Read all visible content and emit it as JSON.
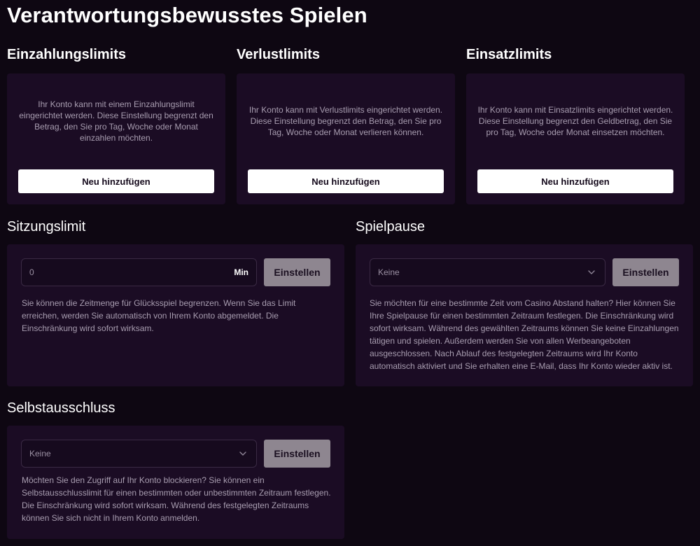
{
  "page": {
    "title": "Verantwortungsbewusstes Spielen"
  },
  "deposit_limits": {
    "title": "Einzahlungslimits",
    "text": "Ihr Konto kann mit einem Einzahlungslimit eingerichtet werden. Diese Einstellung begrenzt den Betrag, den Sie pro Tag, Woche oder Monat einzahlen möchten.",
    "button": "Neu hinzufügen"
  },
  "loss_limits": {
    "title": "Verlustlimits",
    "text": "Ihr Konto kann mit Verlustlimits eingerichtet werden. Diese Einstellung begrenzt den Betrag, den Sie pro Tag, Woche oder Monat verlieren können.",
    "button": "Neu hinzufügen"
  },
  "wager_limits": {
    "title": "Einsatzlimits",
    "text": "Ihr Konto kann mit Einsatzlimits eingerichtet werden. Diese Einstellung begrenzt den Geldbetrag, den Sie pro Tag, Woche oder Monat einsetzen möchten.",
    "button": "Neu hinzufügen"
  },
  "session_limit": {
    "title": "Sitzungslimit",
    "input_value": "0",
    "unit": "Min",
    "button": "Einstellen",
    "text": "Sie können die Zeitmenge für Glücksspiel begrenzen. Wenn Sie das Limit erreichen, werden Sie automatisch von Ihrem Konto abgemeldet. Die Einschränkung wird sofort wirksam."
  },
  "game_pause": {
    "title": "Spielpause",
    "select_value": "Keine",
    "button": "Einstellen",
    "text": "Sie möchten für eine bestimmte Zeit vom Casino Abstand halten? Hier können Sie Ihre Spielpause für einen bestimmten Zeitraum festlegen. Die Einschränkung wird sofort wirksam. Während des gewählten Zeitraums können Sie keine Einzahlungen tätigen und spielen. Außerdem werden Sie von allen Werbeangeboten ausgeschlossen. Nach Ablauf des festgelegten Zeitraums wird Ihr Konto automatisch aktiviert und Sie erhalten eine E-Mail, dass Ihr Konto wieder aktiv ist."
  },
  "self_exclusion": {
    "title": "Selbstausschluss",
    "select_value": "Keine",
    "button": "Einstellen",
    "text": "Möchten Sie den Zugriff auf Ihr Konto blockieren? Sie können ein Selbstausschlusslimit für einen bestimmten oder unbestimmten Zeitraum festlegen. Die Einschränkung wird sofort wirksam. Während des festgelegten Zeitraums können Sie sich nicht in Ihrem Konto anmelden."
  },
  "icons": {
    "dropdown": "chevron-down-icon"
  }
}
